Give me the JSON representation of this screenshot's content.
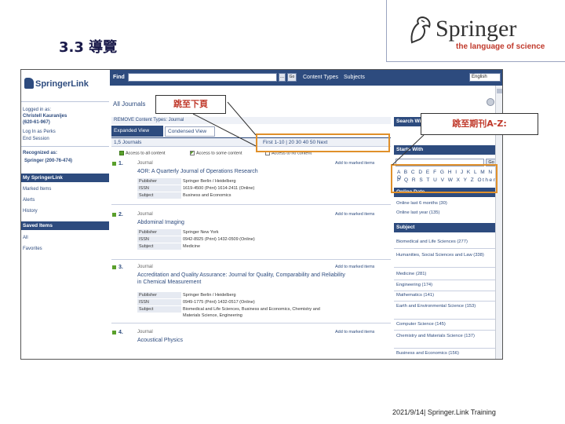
{
  "slide": {
    "title": "3.3 導覽",
    "brand_name": "Springer",
    "brand_tagline": "the language of science",
    "footer": "2021/9/14| Springer.Link Training"
  },
  "annotations": {
    "goto_page": "跳至下頁",
    "goto_journal": "跳至期刊A-Z:"
  },
  "screenshot": {
    "topbar": {
      "find_label": "Find",
      "find_more": "...",
      "find_go": "Go",
      "content_types": "Content Types",
      "subjects": "Subjects",
      "language": "English"
    },
    "sidebar": {
      "logo": "SpringerLink",
      "logged_in": "Logged in as:",
      "user_name": "Christell Kauranijes",
      "user_id": "(620-61-967)",
      "logout": "Log In as Perks",
      "end_session": "End Session",
      "recognized": "Recognized as:",
      "org": "Springer (200-76-474)",
      "my_springerlink": "My SpringerLink",
      "marked_items": "Marked Items",
      "alerts": "Alerts",
      "history": "History",
      "saved_items": "Saved Items",
      "all": "All",
      "favorites": "Favorites"
    },
    "main": {
      "all_journals": "All Journals",
      "remove_filter": "REMOVE Content Types: Journal",
      "tab_expanded": "Expanded View",
      "tab_condensed": "Condensed View",
      "result_count": "1,5 Journals",
      "pager": "First  1-10 | 20  30  40  50  Next",
      "access_all": "Access to all content",
      "access_some": "Access to some content",
      "access_none": "Access to no content",
      "items": [
        {
          "num": "1.",
          "type": "Journal",
          "add": "Add to marked items",
          "title": "4OR: A Quarterly Journal of Operations Research",
          "meta": [
            {
              "k": "Publisher",
              "v": "Springer Berlin / Heidelberg"
            },
            {
              "k": "ISSN",
              "v": "1619-4500 (Print) 1614-2411 (Online)"
            },
            {
              "k": "Subject",
              "v": "Business and Economics"
            }
          ]
        },
        {
          "num": "2.",
          "type": "Journal",
          "add": "Add to marked items",
          "title": "Abdominal Imaging",
          "meta": [
            {
              "k": "Publisher",
              "v": "Springer New York"
            },
            {
              "k": "ISSN",
              "v": "0942-8925 (Print) 1432-0509 (Online)"
            },
            {
              "k": "Subject",
              "v": "Medicine"
            }
          ]
        },
        {
          "num": "3.",
          "type": "Journal",
          "add": "Add to marked items",
          "title": "Accreditation and Quality Assurance: Journal for Quality, Comparability and Reliability in Chemical Measurement",
          "meta": [
            {
              "k": "Publisher",
              "v": "Springer Berlin / Heidelberg"
            },
            {
              "k": "ISSN",
              "v": "0949-1775 (Print) 1432-0517 (Online)"
            },
            {
              "k": "Subject",
              "v": "Biomedical and Life Sciences, Business and Economics, Chemistry and"
            },
            {
              "k": "",
              "v": "Materials Science, Engineering"
            }
          ]
        },
        {
          "num": "4.",
          "type": "Journal",
          "add": "Add to marked items",
          "title": "Acoustical Physics",
          "meta": []
        }
      ]
    },
    "right": {
      "search_within": "Search Within",
      "go": "Go",
      "starts_with": "Starts With",
      "alpha_row1": "A B C D E F G H I J K L M N O",
      "alpha_row2": "P Q R S T U V W X Y Z Other",
      "online_date": "Online Date",
      "date_links": [
        "Online last 6 months (30)",
        "Online last year (135)"
      ],
      "subject": "Subject",
      "subject_links": [
        "Biomedical and Life Sciences (277)",
        "Humanities, Social Sciences and Law (338)",
        "Medicine (281)",
        "Engineering (174)",
        "Mathematics (141)",
        "Earth and Environmental Science (153)",
        "Computer Science (145)",
        "Chemistry and Materials Science (137)",
        "Business and Economics (156)"
      ]
    }
  }
}
